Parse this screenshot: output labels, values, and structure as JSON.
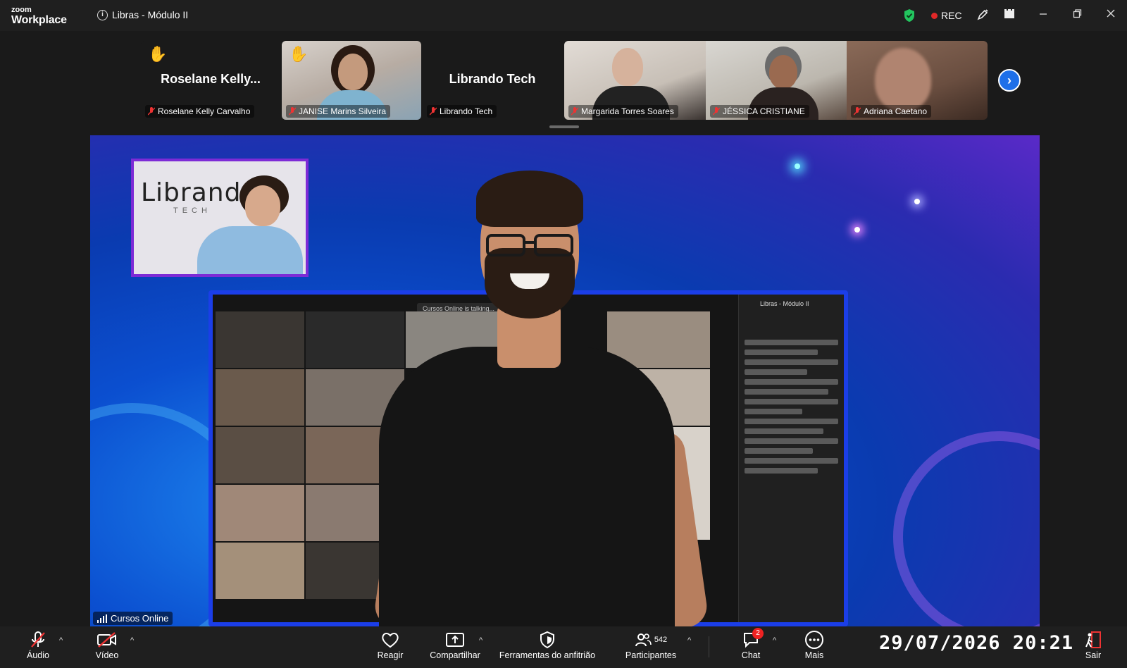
{
  "app": {
    "logo_top": "zoom",
    "logo_bottom": "Workplace"
  },
  "meeting": {
    "title": "Libras - Módulo II",
    "rec_label": "REC"
  },
  "participants": [
    {
      "display": "Roselane  Kelly...",
      "label": "Roselane Kelly Carvalho",
      "hand_raised": true,
      "video": false
    },
    {
      "label": "JANISE Marins Silveira",
      "hand_raised": true,
      "video": true
    },
    {
      "display": "Librando Tech",
      "label": "Librando Tech",
      "hand_raised": false,
      "video": false
    },
    {
      "label": "Margarida Torres Soares",
      "hand_raised": false,
      "video": true
    },
    {
      "label": "JÉSSICA CRISTIANE",
      "hand_raised": false,
      "video": true
    },
    {
      "label": "Adriana Caetano",
      "hand_raised": false,
      "video": true
    }
  ],
  "main_video": {
    "speaker_label": "Cursos Online",
    "pip_logo": "Librando",
    "pip_sub": "TECH",
    "inner_title": "Libras - Módulo II",
    "inner_talking": "Cursos Online is talking..."
  },
  "toolbar": {
    "audio": "Áudio",
    "video": "Vídeo",
    "react": "Reagir",
    "share": "Compartilhar",
    "host_tools": "Ferramentas do anfitrião",
    "participants": "Participantes",
    "participants_count": "542",
    "chat": "Chat",
    "chat_badge": "2",
    "more": "Mais",
    "leave": "Sair"
  },
  "timestamp": "29/07/2026  20:21",
  "colors": {
    "rec": "#e02828",
    "accent_blue": "#1e6fe8",
    "shield_green": "#22c55e",
    "pip_border": "#7d2bd6"
  }
}
